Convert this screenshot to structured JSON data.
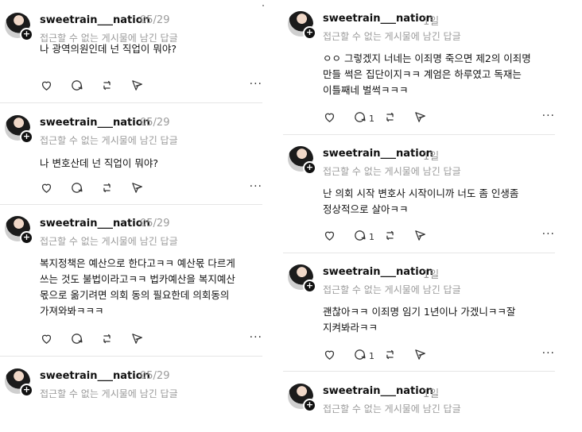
{
  "left_column": {
    "posts": [
      {
        "username": "sweetrain___nation",
        "time": "05/29",
        "reply_note": "접근할 수 없는 게시물에 남긴 답글",
        "lines": [
          "나 광역의원인데 넌 직업이 뭐야?"
        ]
      },
      {
        "username": "sweetrain___nation",
        "time": "05/29",
        "reply_note": "접근할 수 없는 게시물에 남긴 답글",
        "lines": [
          "나 변호산데 넌 직업이 뭐야?"
        ]
      },
      {
        "username": "sweetrain___nation",
        "time": "05/29",
        "reply_note": "접근할 수 없는 게시물에 남긴 답글",
        "lines": [
          "복지정책은 예산으로 한다고ㅋㅋ 예산몫 다르게",
          "쓰는 것도 불법이라고ㅋㅋ 법카예산을 복지예산",
          "몫으로 옮기려면 의회 동의 필요한데 의회동의",
          "가져와봐ㅋㅋㅋ"
        ]
      },
      {
        "username": "sweetrain___nation",
        "time": "05/29",
        "reply_note": "접근할 수 없는 게시물에 남긴 답글",
        "lines": []
      }
    ]
  },
  "right_column": {
    "posts": [
      {
        "username": "sweetrain___nation",
        "time": "1일",
        "reply_note": "접근할 수 없는 게시물에 남긴 답글",
        "lines": [
          "ㅇㅇ 그렇겠지 너네는 이죄명 죽으면 제2의 이죄명",
          "만들 썩은 집단이지ㅋㅋ 계엄은 하루였고 독재는",
          "이틀째네 벌썩ㅋㅋㅋ"
        ],
        "reply_count": "1"
      },
      {
        "username": "sweetrain___nation",
        "time": "1일",
        "reply_note": "접근할 수 없는 게시물에 남긴 답글",
        "lines": [
          "난 의회 시작 변호사 시작이니까 너도 좀 인생좀",
          "정상적으로 살아ㅋㅋ"
        ],
        "reply_count": "1"
      },
      {
        "username": "sweetrain___nation",
        "time": "1일",
        "reply_note": "접근할 수 없는 게시물에 남긴 답글",
        "lines": [
          "괜찮아ㅋㅋ 이죄명 임기 1년이나 가겠니ㅋㅋ잘",
          "지켜봐라ㅋㅋ"
        ],
        "reply_count": "1"
      },
      {
        "username": "sweetrain___nation",
        "time": "1일",
        "reply_note": "접근할 수 없는 게시물에 남긴 답글",
        "lines": []
      }
    ]
  },
  "icons": {
    "like": "heart-icon",
    "comment": "comment-icon",
    "repost": "repost-icon",
    "share": "share-icon",
    "more": "more-icon"
  },
  "more_glyph": "···"
}
